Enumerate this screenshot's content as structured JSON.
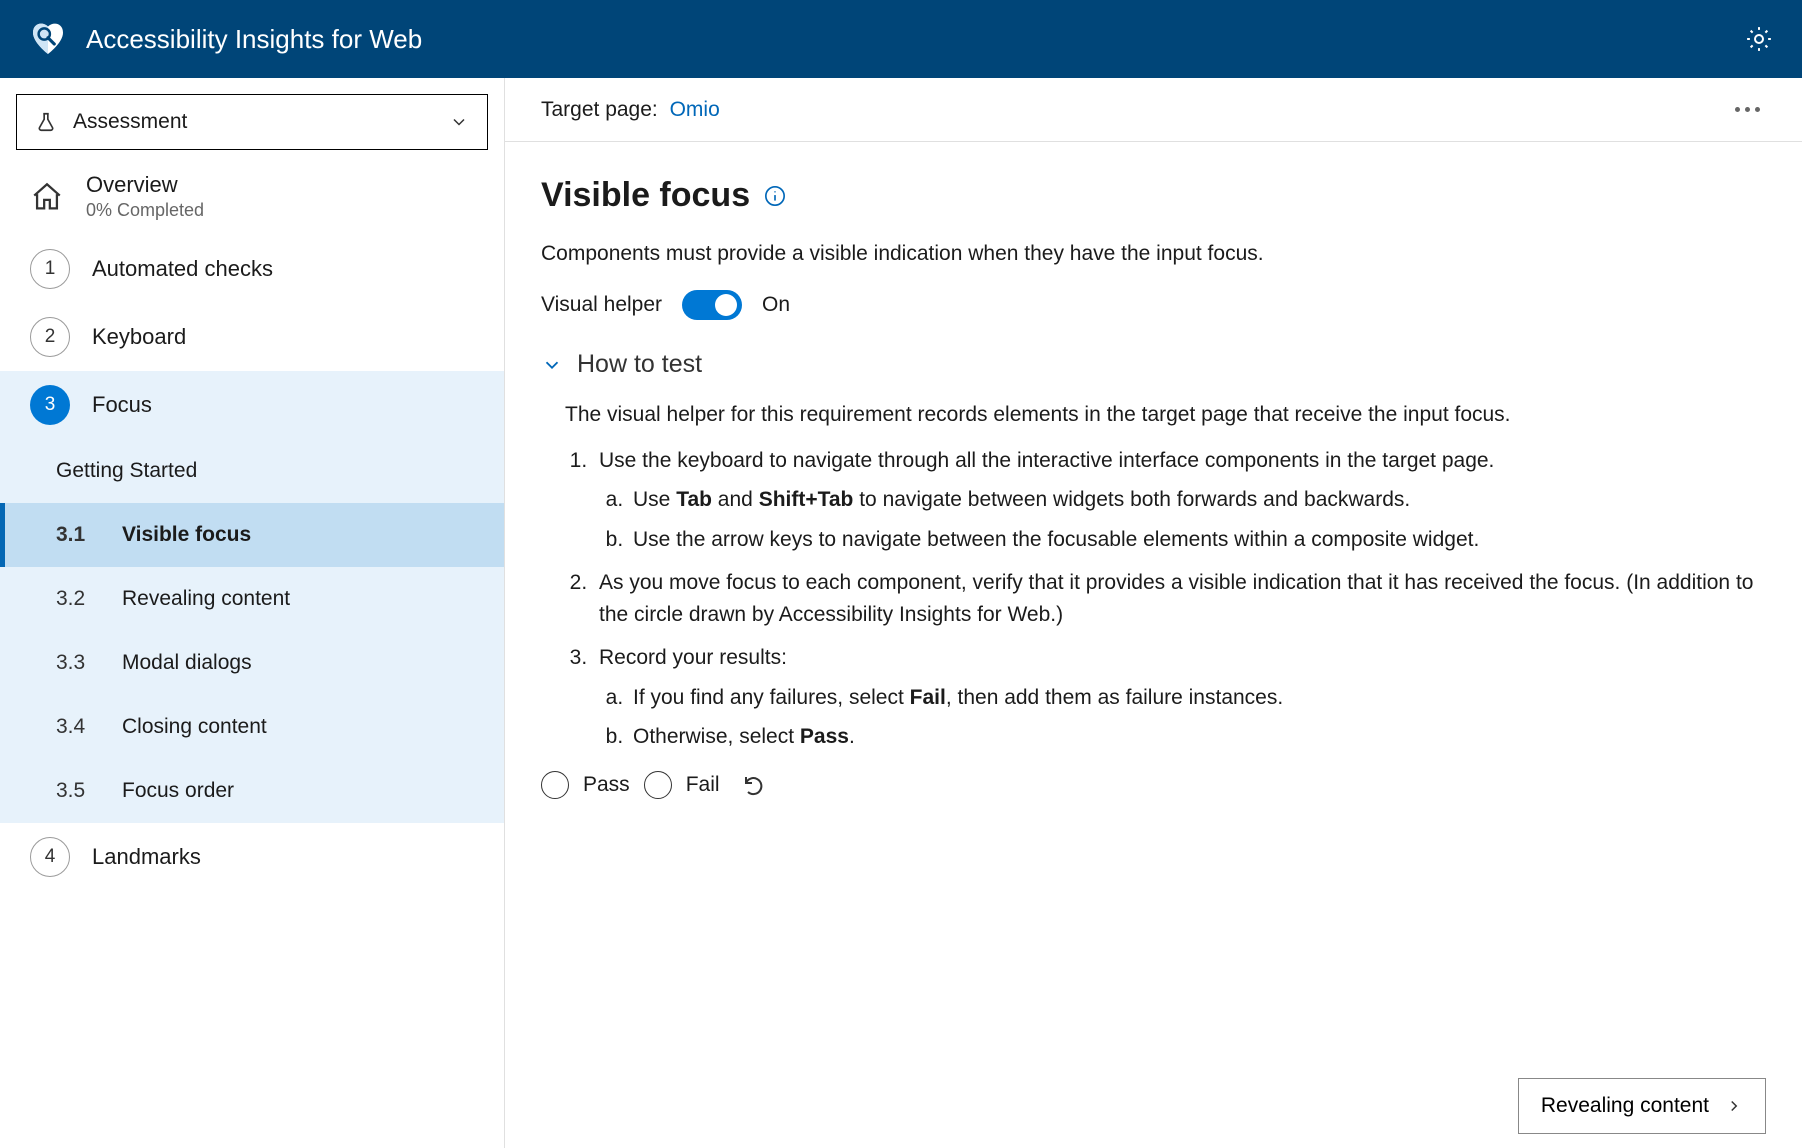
{
  "header": {
    "title": "Accessibility Insights for Web"
  },
  "mode": {
    "label": "Assessment"
  },
  "overview": {
    "title": "Overview",
    "subtitle": "0% Completed"
  },
  "nav": {
    "item1": "Automated checks",
    "item2": "Keyboard",
    "item3": "Focus",
    "item4": "Landmarks"
  },
  "focus_sub": {
    "getting_started": "Getting Started",
    "s1_num": "3.1",
    "s1_label": "Visible focus",
    "s2_num": "3.2",
    "s2_label": "Revealing content",
    "s3_num": "3.3",
    "s3_label": "Modal dialogs",
    "s4_num": "3.4",
    "s4_label": "Closing content",
    "s5_num": "3.5",
    "s5_label": "Focus order"
  },
  "target": {
    "label": "Target page: ",
    "link": "Omio"
  },
  "page": {
    "title": "Visible focus",
    "description": "Components must provide a visible indication when they have the input focus.",
    "helper_label": "Visual helper",
    "helper_state": "On",
    "howto_title": "How to test",
    "intro": "The visual helper for this requirement records elements in the target page that receive the input focus.",
    "step1": "Use the keyboard to navigate through all the interactive interface components in the target page.",
    "step1a_pre": "Use ",
    "step1a_b1": "Tab",
    "step1a_mid": " and ",
    "step1a_b2": "Shift+Tab",
    "step1a_post": " to navigate between widgets both forwards and backwards.",
    "step1b": "Use the arrow keys to navigate between the focusable elements within a composite widget.",
    "step2": "As you move focus to each component, verify that it provides a visible indication that it has received the focus. (In addition to the circle drawn by Accessibility Insights for Web.)",
    "step3": "Record your results:",
    "step3a_pre": "If you find any failures, select ",
    "step3a_b": "Fail",
    "step3a_post": ", then add them as failure instances.",
    "step3b_pre": "Otherwise, select ",
    "step3b_b": "Pass",
    "step3b_post": "."
  },
  "results": {
    "pass": "Pass",
    "fail": "Fail"
  },
  "next": {
    "label": "Revealing content"
  }
}
